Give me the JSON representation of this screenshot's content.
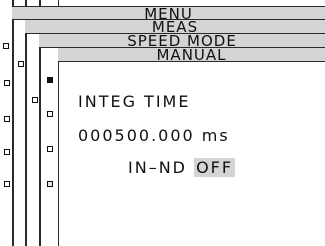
{
  "menu_levels": [
    {
      "label": "MENU"
    },
    {
      "label": "MEAS"
    },
    {
      "label": "SPEED MODE"
    },
    {
      "label": "MANUAL"
    }
  ],
  "content": {
    "param_label": "INTEG TIME",
    "param_value": "000500.000 ms",
    "option_label": "IN–ND",
    "option_value": "OFF"
  },
  "colors": {
    "bar_background": "#d4d4d4",
    "line": "#2a2a2a",
    "text": "#111111"
  }
}
